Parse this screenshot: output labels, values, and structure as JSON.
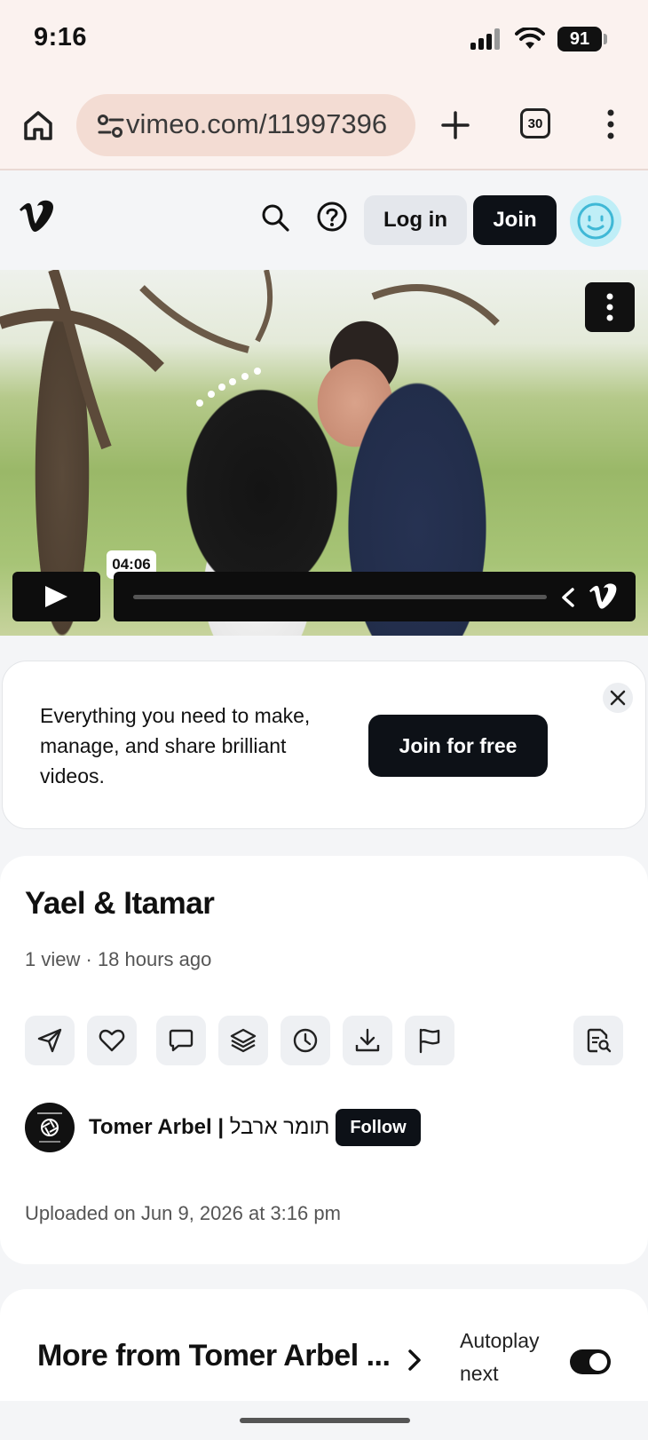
{
  "status_bar": {
    "time": "9:16",
    "battery": "91"
  },
  "browser": {
    "url": "vimeo.com/11997396",
    "tab_count": "30"
  },
  "header": {
    "login_label": "Log in",
    "join_label": "Join"
  },
  "video": {
    "time_tooltip": "04:06",
    "progress": 0.0
  },
  "promo": {
    "text": "Everything you need to make, manage, and share brilliant videos.",
    "cta_label": "Join for free"
  },
  "info": {
    "title": "Yael & Itamar",
    "views": "1 view",
    "age": "18 hours ago",
    "actions": [
      "share-icon",
      "like-icon",
      "comment-icon",
      "collections-icon",
      "watch-later-icon",
      "download-icon",
      "report-icon",
      "transcript-icon"
    ],
    "owner_name": "Tomer Arbel |",
    "owner_name_hebrew": "תומר ארבל",
    "follow_label": "Follow",
    "uploaded": "Uploaded on Jun 9, 2026 at 3:16 pm"
  },
  "more": {
    "title": "More from Tomer Arbel ...",
    "autoplay_label": "Autoplay next",
    "autoplay_on": true
  },
  "colors": {
    "brand_dark": "#0d1117",
    "browser_bg": "#fbf2ef",
    "url_bg": "#f3dcd3",
    "avatar_bg": "#bfeef7"
  }
}
